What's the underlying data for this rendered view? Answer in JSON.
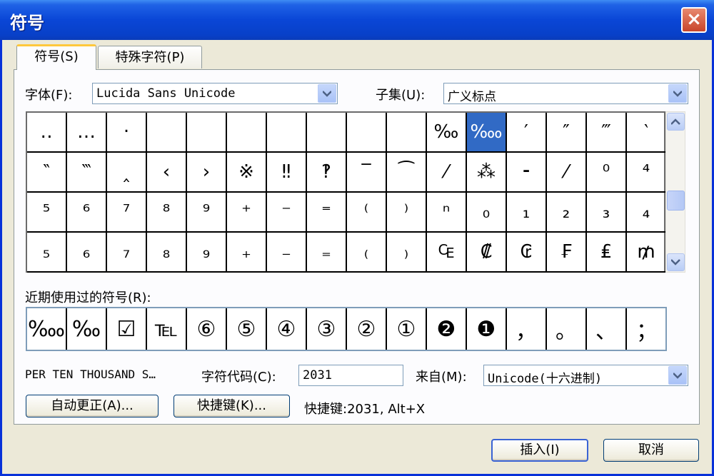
{
  "window": {
    "title": "符号",
    "close_label": "×"
  },
  "tabs": [
    {
      "label": "符号(S)"
    },
    {
      "label": "特殊字符(P)"
    }
  ],
  "font": {
    "label": "字体(F):",
    "value": "Lucida Sans Unicode"
  },
  "subset": {
    "label": "子集(U):",
    "value": "广义标点"
  },
  "symbol_grid": {
    "rows": [
      [
        "‥",
        "…",
        "‧",
        "",
        "",
        "",
        "",
        "",
        "",
        "",
        "‰",
        "‱",
        "′",
        "″",
        "‴",
        "‵"
      ],
      [
        "‶",
        "‷",
        "‸",
        "‹",
        "›",
        "※",
        "‼",
        "‽",
        "‾",
        "⁀",
        "⁄",
        "⁂",
        "⁃",
        "⁄",
        "⁰",
        "⁴"
      ],
      [
        "⁵",
        "⁶",
        "⁷",
        "⁸",
        "⁹",
        "⁺",
        "⁻",
        "⁼",
        "⁽",
        "⁾",
        "ⁿ",
        "₀",
        "₁",
        "₂",
        "₃",
        "₄"
      ],
      [
        "₅",
        "₆",
        "₇",
        "₈",
        "₉",
        "₊",
        "₋",
        "₌",
        "₍",
        "₎",
        "₠",
        "₡",
        "₢",
        "₣",
        "₤",
        "₥"
      ]
    ],
    "selected": "‱"
  },
  "recent": {
    "label": "近期使用过的符号(R):",
    "symbols": [
      "‱",
      "‰",
      "☑",
      "℡",
      "⑥",
      "⑤",
      "④",
      "③",
      "②",
      "①",
      "❷",
      "❶",
      "，",
      "。",
      "、",
      "；"
    ]
  },
  "char_name": "PER TEN THOUSAND S…",
  "char_code": {
    "label": "字符代码(C):",
    "value": "2031"
  },
  "from": {
    "label": "来自(M):",
    "value": "Unicode(十六进制)"
  },
  "buttons": {
    "autocorrect": "自动更正(A)...",
    "shortcut_key": "快捷键(K)...",
    "insert": "插入(I)",
    "cancel": "取消"
  },
  "shortcut_info": "快捷键:2031, Alt+X",
  "icons": [
    "close-icon",
    "dropdown-arrow-icon",
    "scroll-up-icon",
    "scroll-down-icon"
  ]
}
